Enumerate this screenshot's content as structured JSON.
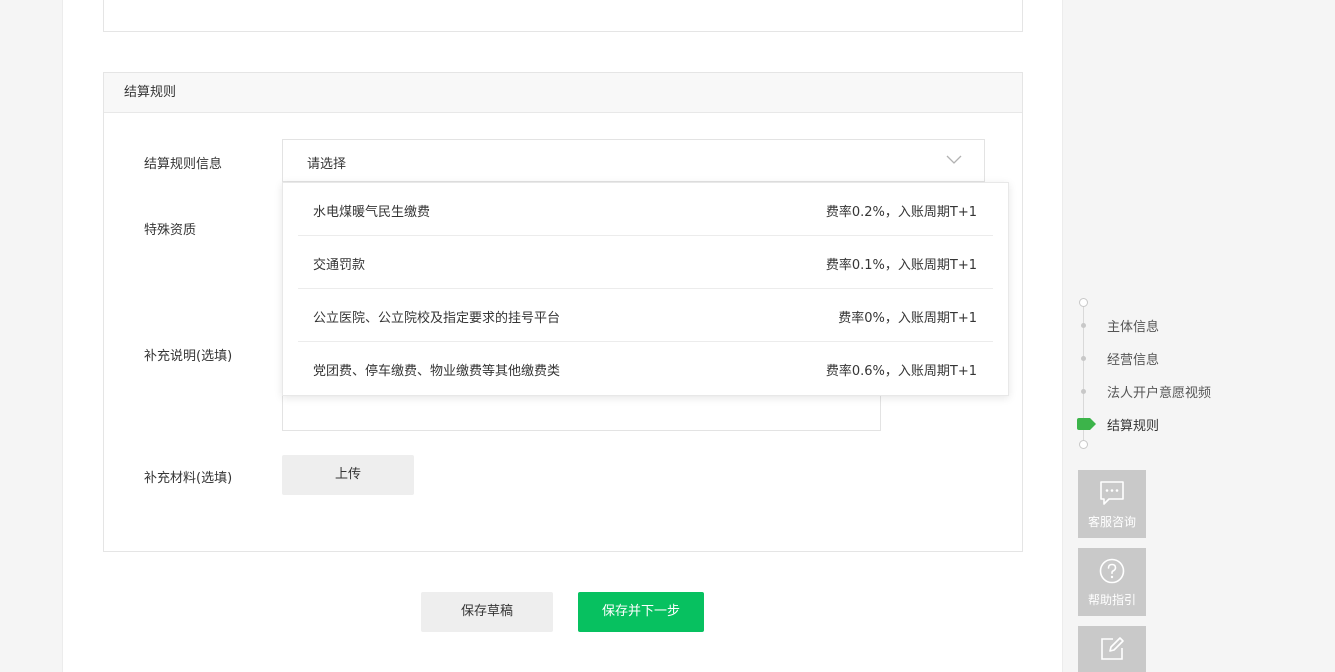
{
  "section": {
    "title": "结算规则"
  },
  "form": {
    "settlement_label": "结算规则信息",
    "settlement_placeholder": "请选择",
    "special_qual_label": "特殊资质",
    "supplement_note_label": "补充说明(选填)",
    "supplement_material_label": "补充材料(选填)",
    "upload_label": "上传"
  },
  "dropdown": {
    "options": [
      {
        "name": "水电煤暖气民生缴费",
        "rate": "费率0.2%，入账周期T+1"
      },
      {
        "name": "交通罚款",
        "rate": "费率0.1%，入账周期T+1"
      },
      {
        "name": "公立医院、公立院校及指定要求的挂号平台",
        "rate": "费率0%，入账周期T+1"
      },
      {
        "name": "党团费、停车缴费、物业缴费等其他缴费类",
        "rate": "费率0.6%，入账周期T+1"
      }
    ]
  },
  "actions": {
    "save_draft": "保存草稿",
    "save_next": "保存并下一步"
  },
  "steps": {
    "items": [
      {
        "label": "主体信息"
      },
      {
        "label": "经营信息"
      },
      {
        "label": "法人开户意愿视频"
      },
      {
        "label": "结算规则",
        "active": true
      }
    ]
  },
  "tools": {
    "customer_service": "客服咨询",
    "help_guide": "帮助指引",
    "third_icon": "edit-icon"
  },
  "colors": {
    "brand_green": "#07c160",
    "step_active": "#3cb44a"
  }
}
